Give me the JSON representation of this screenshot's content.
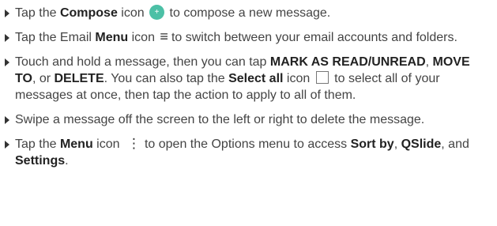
{
  "items": [
    {
      "parts": [
        "Tap the ",
        "Compose",
        " icon",
        "to compose a new message."
      ],
      "icon": "compose-icon"
    },
    {
      "parts": [
        "Tap the Email ",
        "Menu",
        " icon",
        "to switch between your email accounts and folders."
      ],
      "icon": "hamburger-menu-icon"
    },
    {
      "parts": [
        "Touch and hold a message, then you can tap ",
        "MARK AS READ/UNREAD",
        ", ",
        "MOVE TO",
        ", or ",
        "DELETE",
        ". You can also tap the ",
        "Select all",
        " icon",
        "to select all of your messages at once, then tap the action to apply to all of them."
      ],
      "icon": "select-all-checkbox-icon"
    },
    {
      "parts": [
        "Swipe a message off the screen to the left or right to delete the message."
      ]
    },
    {
      "parts": [
        "Tap the ",
        "Menu",
        " icon",
        "to open the Options menu to access ",
        "Sort by",
        ", ",
        "QSlide",
        ", and ",
        "Settings",
        "."
      ],
      "icon": "vertical-dots-menu-icon"
    }
  ],
  "colors": {
    "text": "#444444",
    "compose_icon": "#4cc0a6"
  }
}
